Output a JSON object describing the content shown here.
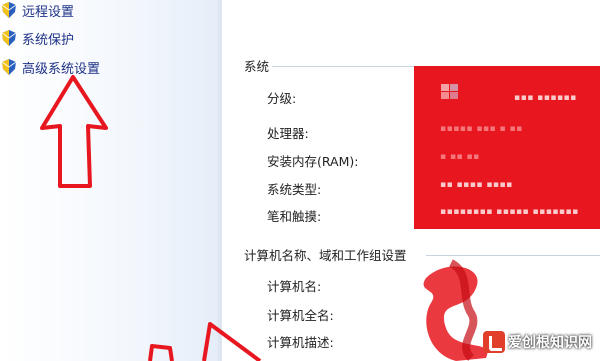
{
  "left_pane": {
    "links": [
      {
        "label": "远程设置",
        "icon": "shield-icon"
      },
      {
        "label": "系统保护",
        "icon": "shield-icon"
      },
      {
        "label": "高级系统设置",
        "icon": "shield-icon"
      }
    ]
  },
  "system_section": {
    "title": "系统",
    "labels": [
      "分级:",
      "处理器:",
      "安装内存(RAM):",
      "系统类型:",
      "笔和触摸:"
    ]
  },
  "computer_section": {
    "title": "计算机名称、域和工作组设置",
    "labels": [
      "计算机名:",
      "计算机全名:",
      "计算机描述:"
    ]
  },
  "watermark": {
    "text": "爱创根知识网"
  },
  "colors": {
    "link": "#1e3287",
    "arrow": "#e8161f",
    "redaction": "#e8161f",
    "divider": "#c9d3df"
  }
}
